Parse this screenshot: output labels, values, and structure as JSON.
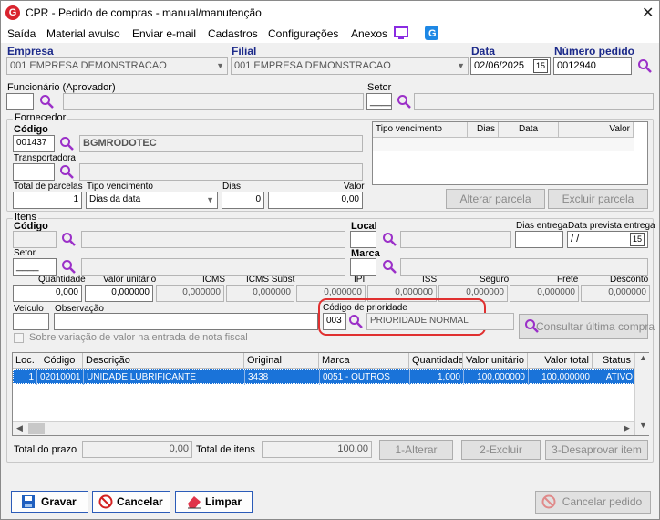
{
  "window": {
    "title": "CPR - Pedido de compras - manual/manutenção",
    "app_icon": "G",
    "close": "✕"
  },
  "menu": [
    "Saída",
    "Material avulso",
    "Enviar e-mail",
    "Cadastros",
    "Configurações",
    "Anexos"
  ],
  "header": {
    "empresa_label": "Empresa",
    "empresa_value": "001 EMPRESA DEMONSTRACAO",
    "filial_label": "Filial",
    "filial_value": "001 EMPRESA DEMONSTRACAO",
    "data_label": "Data",
    "data_value": "02/06/2025",
    "numero_label": "Número pedido",
    "numero_value": "0012940",
    "cal_icon": "15"
  },
  "funcionario": {
    "label": "Funcionário (Aprovador)",
    "code": "",
    "name": ""
  },
  "setor": {
    "label": "Setor",
    "code": "____",
    "name": ""
  },
  "fornecedor": {
    "group": "Fornecedor",
    "codigo_label": "Código",
    "codigo_value": "001437",
    "nome_value": "BGMRODOTEC",
    "transportadora_label": "Transportadora",
    "total_parcelas_label": "Total de parcelas",
    "total_parcelas_value": "1",
    "tipo_venc_label": "Tipo vencimento",
    "tipo_venc_value": "Dias da data",
    "dias_label": "Dias",
    "dias_value": "0",
    "valor_label": "Valor",
    "valor_value": "0,00",
    "table_cols": [
      "Tipo vencimento",
      "Dias",
      "Data",
      "Valor"
    ],
    "alterar_parcela": "Alterar parcela",
    "excluir_parcela": "Excluir parcela"
  },
  "itens": {
    "group": "Itens",
    "codigo_label": "Código",
    "local_label": "Local",
    "dias_entrega_label": "Dias entrega",
    "data_prevista_label": "Data prevista entrega",
    "data_prevista_value": "/ /",
    "setor_label": "Setor",
    "setor_value": "____",
    "marca_label": "Marca",
    "num_labels": [
      "Quantidade",
      "Valor unitário",
      "ICMS",
      "ICMS Subst",
      "IPI",
      "ISS",
      "Seguro",
      "Frete",
      "Desconto"
    ],
    "num_values": [
      "0,000",
      "0,000000",
      "0,000000",
      "0,000000",
      "0,000000",
      "0,000000",
      "0,000000",
      "0,000000",
      "0,000000"
    ],
    "veiculo_label": "Veículo",
    "observacao_label": "Observação",
    "prioridade_label": "Código de prioridade",
    "prioridade_code": "003",
    "prioridade_name": "PRIORIDADE NORMAL",
    "consultar": "Consultar última compra",
    "sobre_variacao": "Sobre variação de valor na entrada de nota fiscal"
  },
  "grid": {
    "columns": [
      "Loc.",
      "Código",
      "Descrição",
      "Original",
      "Marca",
      "Quantidade",
      "Valor unitário",
      "Valor total",
      "Status"
    ],
    "rows": [
      [
        "1",
        "02010001",
        "UNIDADE LUBRIFICANTE",
        "3438",
        "0051 - OUTROS",
        "1,000",
        "100,000000",
        "100,000000",
        "ATIVO"
      ]
    ]
  },
  "totals": {
    "prazo_label": "Total do prazo",
    "prazo_value": "0,00",
    "itens_label": "Total de itens",
    "itens_value": "100,00",
    "alterar": "1-Alterar",
    "excluir": "2-Excluir",
    "desaprovar": "3-Desaprovar item"
  },
  "footer": {
    "gravar": "Gravar",
    "cancelar": "Cancelar",
    "limpar": "Limpar",
    "cancelar_pedido": "Cancelar pedido"
  }
}
